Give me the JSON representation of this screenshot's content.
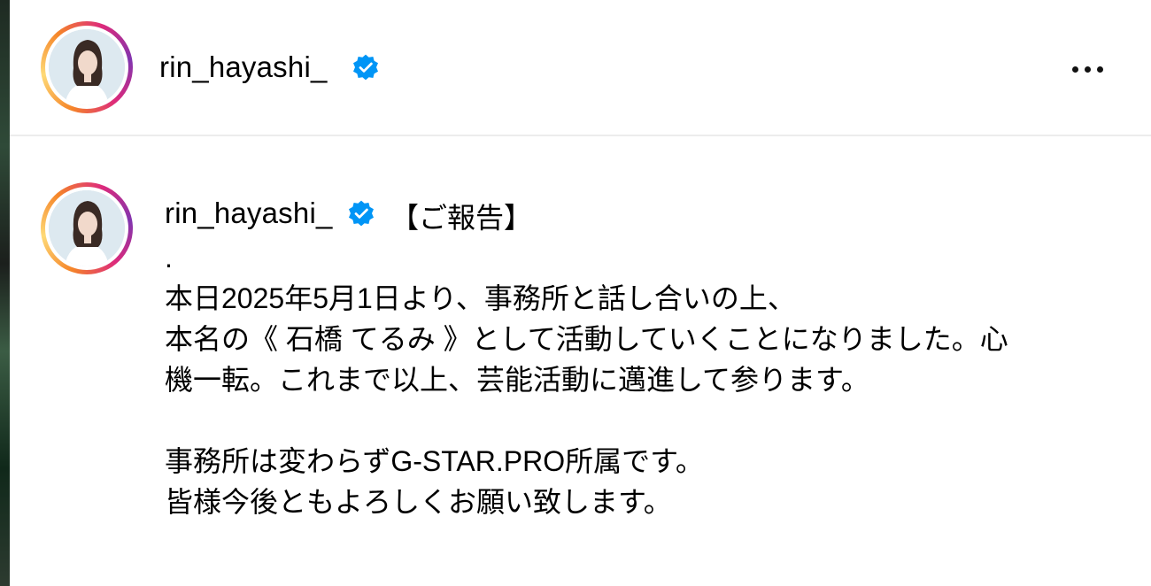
{
  "header": {
    "username": "rin_hayashi_",
    "verified_icon": "verified-badge-icon",
    "more_icon": "more-horizontal-icon"
  },
  "caption": {
    "username": "rin_hayashi_",
    "title": "【ご報告】",
    "lines": [
      ".",
      "本日2025年5月1日より、事務所と話し合いの上、",
      "本名の《 石橋 てるみ 》として活動していくことになりました。心",
      "機一転。これまで以上、芸能活動に邁進して参ります。",
      "",
      "事務所は変わらずG-STAR.PRO所属です。",
      "皆様今後ともよろしくお願い致します。"
    ]
  },
  "colors": {
    "verified_blue": "#0095f6",
    "ring_gradient": [
      "#f58529",
      "#feda77",
      "#dd2a7b",
      "#8134af"
    ],
    "divider": "#ececec"
  }
}
